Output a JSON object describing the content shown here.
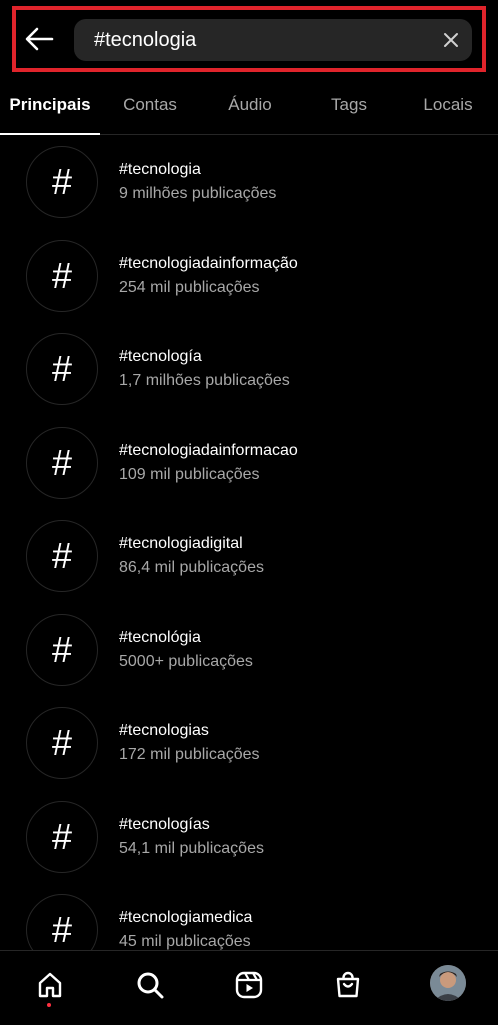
{
  "search": {
    "query": "#tecnologia"
  },
  "tabs": [
    {
      "label": "Principais"
    },
    {
      "label": "Contas"
    },
    {
      "label": "Áudio"
    },
    {
      "label": "Tags"
    },
    {
      "label": "Locais"
    }
  ],
  "results": [
    {
      "icon": "#",
      "title": "#tecnologia",
      "subtitle": "9 milhões publicações"
    },
    {
      "icon": "#",
      "title": "#tecnologiadainformação",
      "subtitle": "254 mil publicações"
    },
    {
      "icon": "#",
      "title": "#tecnología",
      "subtitle": "1,7 milhões publicações"
    },
    {
      "icon": "#",
      "title": "#tecnologiadainformacao",
      "subtitle": "109 mil publicações"
    },
    {
      "icon": "#",
      "title": "#tecnologiadigital",
      "subtitle": "86,4 mil publicações"
    },
    {
      "icon": "#",
      "title": "#tecnológia",
      "subtitle": "5000+ publicações"
    },
    {
      "icon": "#",
      "title": "#tecnologias",
      "subtitle": "172 mil publicações"
    },
    {
      "icon": "#",
      "title": "#tecnologías",
      "subtitle": "54,1 mil publicações"
    },
    {
      "icon": "#",
      "title": "#tecnologiamedica",
      "subtitle": "45 mil publicações"
    }
  ],
  "nav": {
    "items": [
      "home-icon",
      "search-icon",
      "reels-icon",
      "shop-icon",
      "profile-avatar"
    ]
  },
  "colors": {
    "background": "#000000",
    "highlight_border": "#e0242b",
    "search_field": "#262626",
    "secondary_text": "#a8a8a8",
    "notification_dot": "#ff3040"
  }
}
